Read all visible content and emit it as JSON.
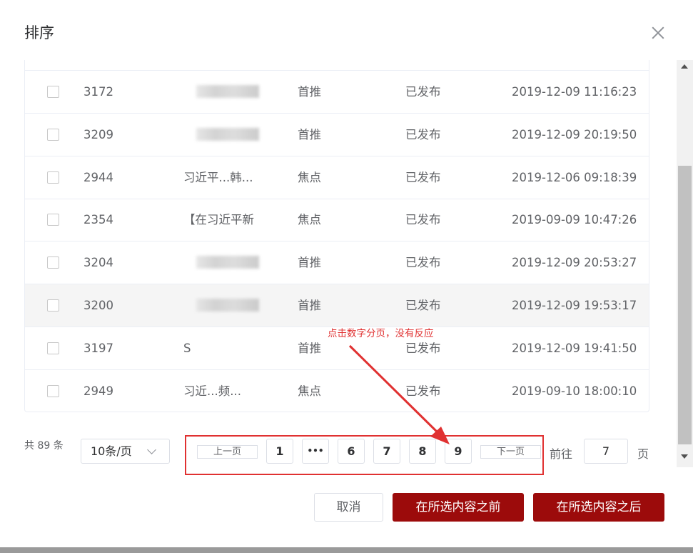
{
  "dialog": {
    "title": "排序"
  },
  "rows": [
    {
      "id": "3172",
      "title": "",
      "type": "首推",
      "status": "已发布",
      "date": "2019-12-09 11:16:23",
      "highlighted": false
    },
    {
      "id": "3209",
      "title": "",
      "type": "首推",
      "status": "已发布",
      "date": "2019-12-09 20:19:50",
      "highlighted": false
    },
    {
      "id": "2944",
      "title": "习近平...韩...",
      "type": "焦点",
      "status": "已发布",
      "date": "2019-12-06 09:18:39",
      "highlighted": false
    },
    {
      "id": "2354",
      "title": "【在习近平新",
      "type": "焦点",
      "status": "已发布",
      "date": "2019-09-09 10:47:26",
      "highlighted": false
    },
    {
      "id": "3204",
      "title": "",
      "type": "首推",
      "status": "已发布",
      "date": "2019-12-09 20:53:27",
      "highlighted": false
    },
    {
      "id": "3200",
      "title": "",
      "type": "首推",
      "status": "已发布",
      "date": "2019-12-09 19:53:17",
      "highlighted": true
    },
    {
      "id": "3197",
      "title": "S",
      "type": "首推",
      "status": "已发布",
      "date": "2019-12-09 19:41:50",
      "highlighted": false
    },
    {
      "id": "2949",
      "title": "习近...频...",
      "type": "焦点",
      "status": "已发布",
      "date": "2019-09-10 18:00:10",
      "highlighted": false
    }
  ],
  "pagination": {
    "total_label": "共 89 条",
    "page_size": "10条/页",
    "prev_label": "上一页",
    "next_label": "下一页",
    "pages": [
      "1",
      "•••",
      "6",
      "7",
      "8",
      "9"
    ],
    "goto_prefix": "前往",
    "goto_value": "7",
    "goto_suffix": "页"
  },
  "annotation": {
    "text": "点击数字分页，没有反应",
    "color": "#e03131"
  },
  "footer": {
    "cancel_label": "取消",
    "before_label": "在所选内容之前",
    "after_label": "在所选内容之后"
  },
  "colors": {
    "primary": "#9c0b0b",
    "annotation": "#e03131",
    "row_highlight": "#f5f5f5"
  }
}
